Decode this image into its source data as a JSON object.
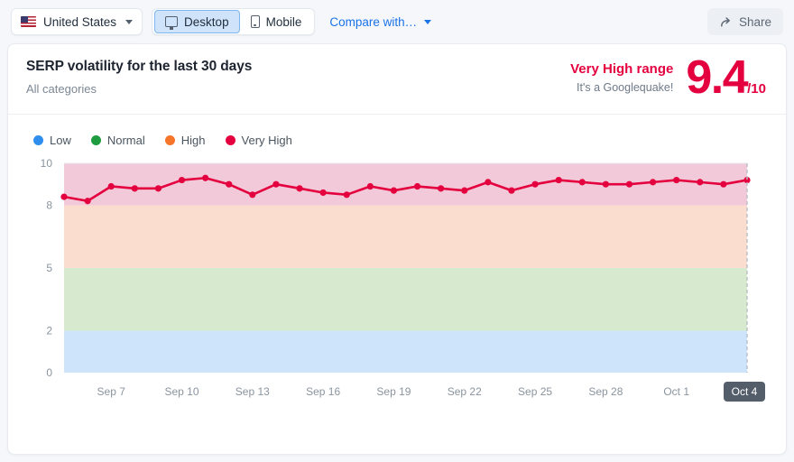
{
  "toolbar": {
    "country": "United States",
    "country_icon": "us-flag-icon",
    "device_desktop": "Desktop",
    "device_mobile": "Mobile",
    "device_selected": "Desktop",
    "compare": "Compare with…",
    "share": "Share",
    "share_icon": "share-arrow-icon"
  },
  "card": {
    "title": "SERP volatility for the last 30 days",
    "subtitle": "All categories",
    "score": {
      "range_label": "Very High range",
      "note": "It's a Googlequake!",
      "value": "9.4",
      "denominator": "/10",
      "color": "#e4003f"
    }
  },
  "legend": [
    {
      "label": "Low",
      "color": "#2f8ded"
    },
    {
      "label": "Normal",
      "color": "#1f9c3f"
    },
    {
      "label": "High",
      "color": "#f5762a"
    },
    {
      "label": "Very High",
      "color": "#e4003f"
    }
  ],
  "chart_data": {
    "type": "line",
    "title": "SERP volatility for the last 30 days",
    "xlabel": "",
    "ylabel": "",
    "ylim": [
      0,
      10
    ],
    "yticks": [
      0,
      2,
      5,
      8,
      10
    ],
    "grid": false,
    "legend_position": "top-left",
    "series": [
      {
        "name": "Very High",
        "color": "#e4003f",
        "values": [
          8.4,
          8.2,
          8.9,
          8.8,
          8.8,
          9.2,
          9.3,
          9.0,
          8.5,
          9.0,
          8.8,
          8.6,
          8.5,
          8.9,
          8.7,
          8.9,
          8.8,
          8.7,
          9.1,
          8.7,
          9.0,
          9.2,
          9.1,
          9.0,
          9.0,
          9.1,
          9.2,
          9.1,
          9.0,
          9.2
        ]
      }
    ],
    "x": [
      "Sep 5",
      "Sep 6",
      "Sep 7",
      "Sep 8",
      "Sep 9",
      "Sep 10",
      "Sep 11",
      "Sep 12",
      "Sep 13",
      "Sep 14",
      "Sep 15",
      "Sep 16",
      "Sep 17",
      "Sep 18",
      "Sep 19",
      "Sep 20",
      "Sep 21",
      "Sep 22",
      "Sep 23",
      "Sep 24",
      "Sep 25",
      "Sep 26",
      "Sep 27",
      "Sep 28",
      "Sep 29",
      "Sep 30",
      "Oct 1",
      "Oct 2",
      "Oct 3",
      "Oct 4"
    ],
    "xticks": [
      "Sep 7",
      "Sep 10",
      "Sep 13",
      "Sep 16",
      "Sep 19",
      "Sep 22",
      "Sep 25",
      "Sep 28",
      "Oct 1",
      "Oct 4"
    ],
    "xtick_highlight": "Oct 4",
    "bands": [
      {
        "name": "Low",
        "from": 0,
        "to": 2,
        "color": "#cde4fa"
      },
      {
        "name": "Normal",
        "from": 2,
        "to": 5,
        "color": "#d7e9ce"
      },
      {
        "name": "High",
        "from": 5,
        "to": 8,
        "color": "#fbddd0"
      },
      {
        "name": "Very High",
        "from": 8,
        "to": 10,
        "color": "#f2c9d9"
      }
    ]
  }
}
